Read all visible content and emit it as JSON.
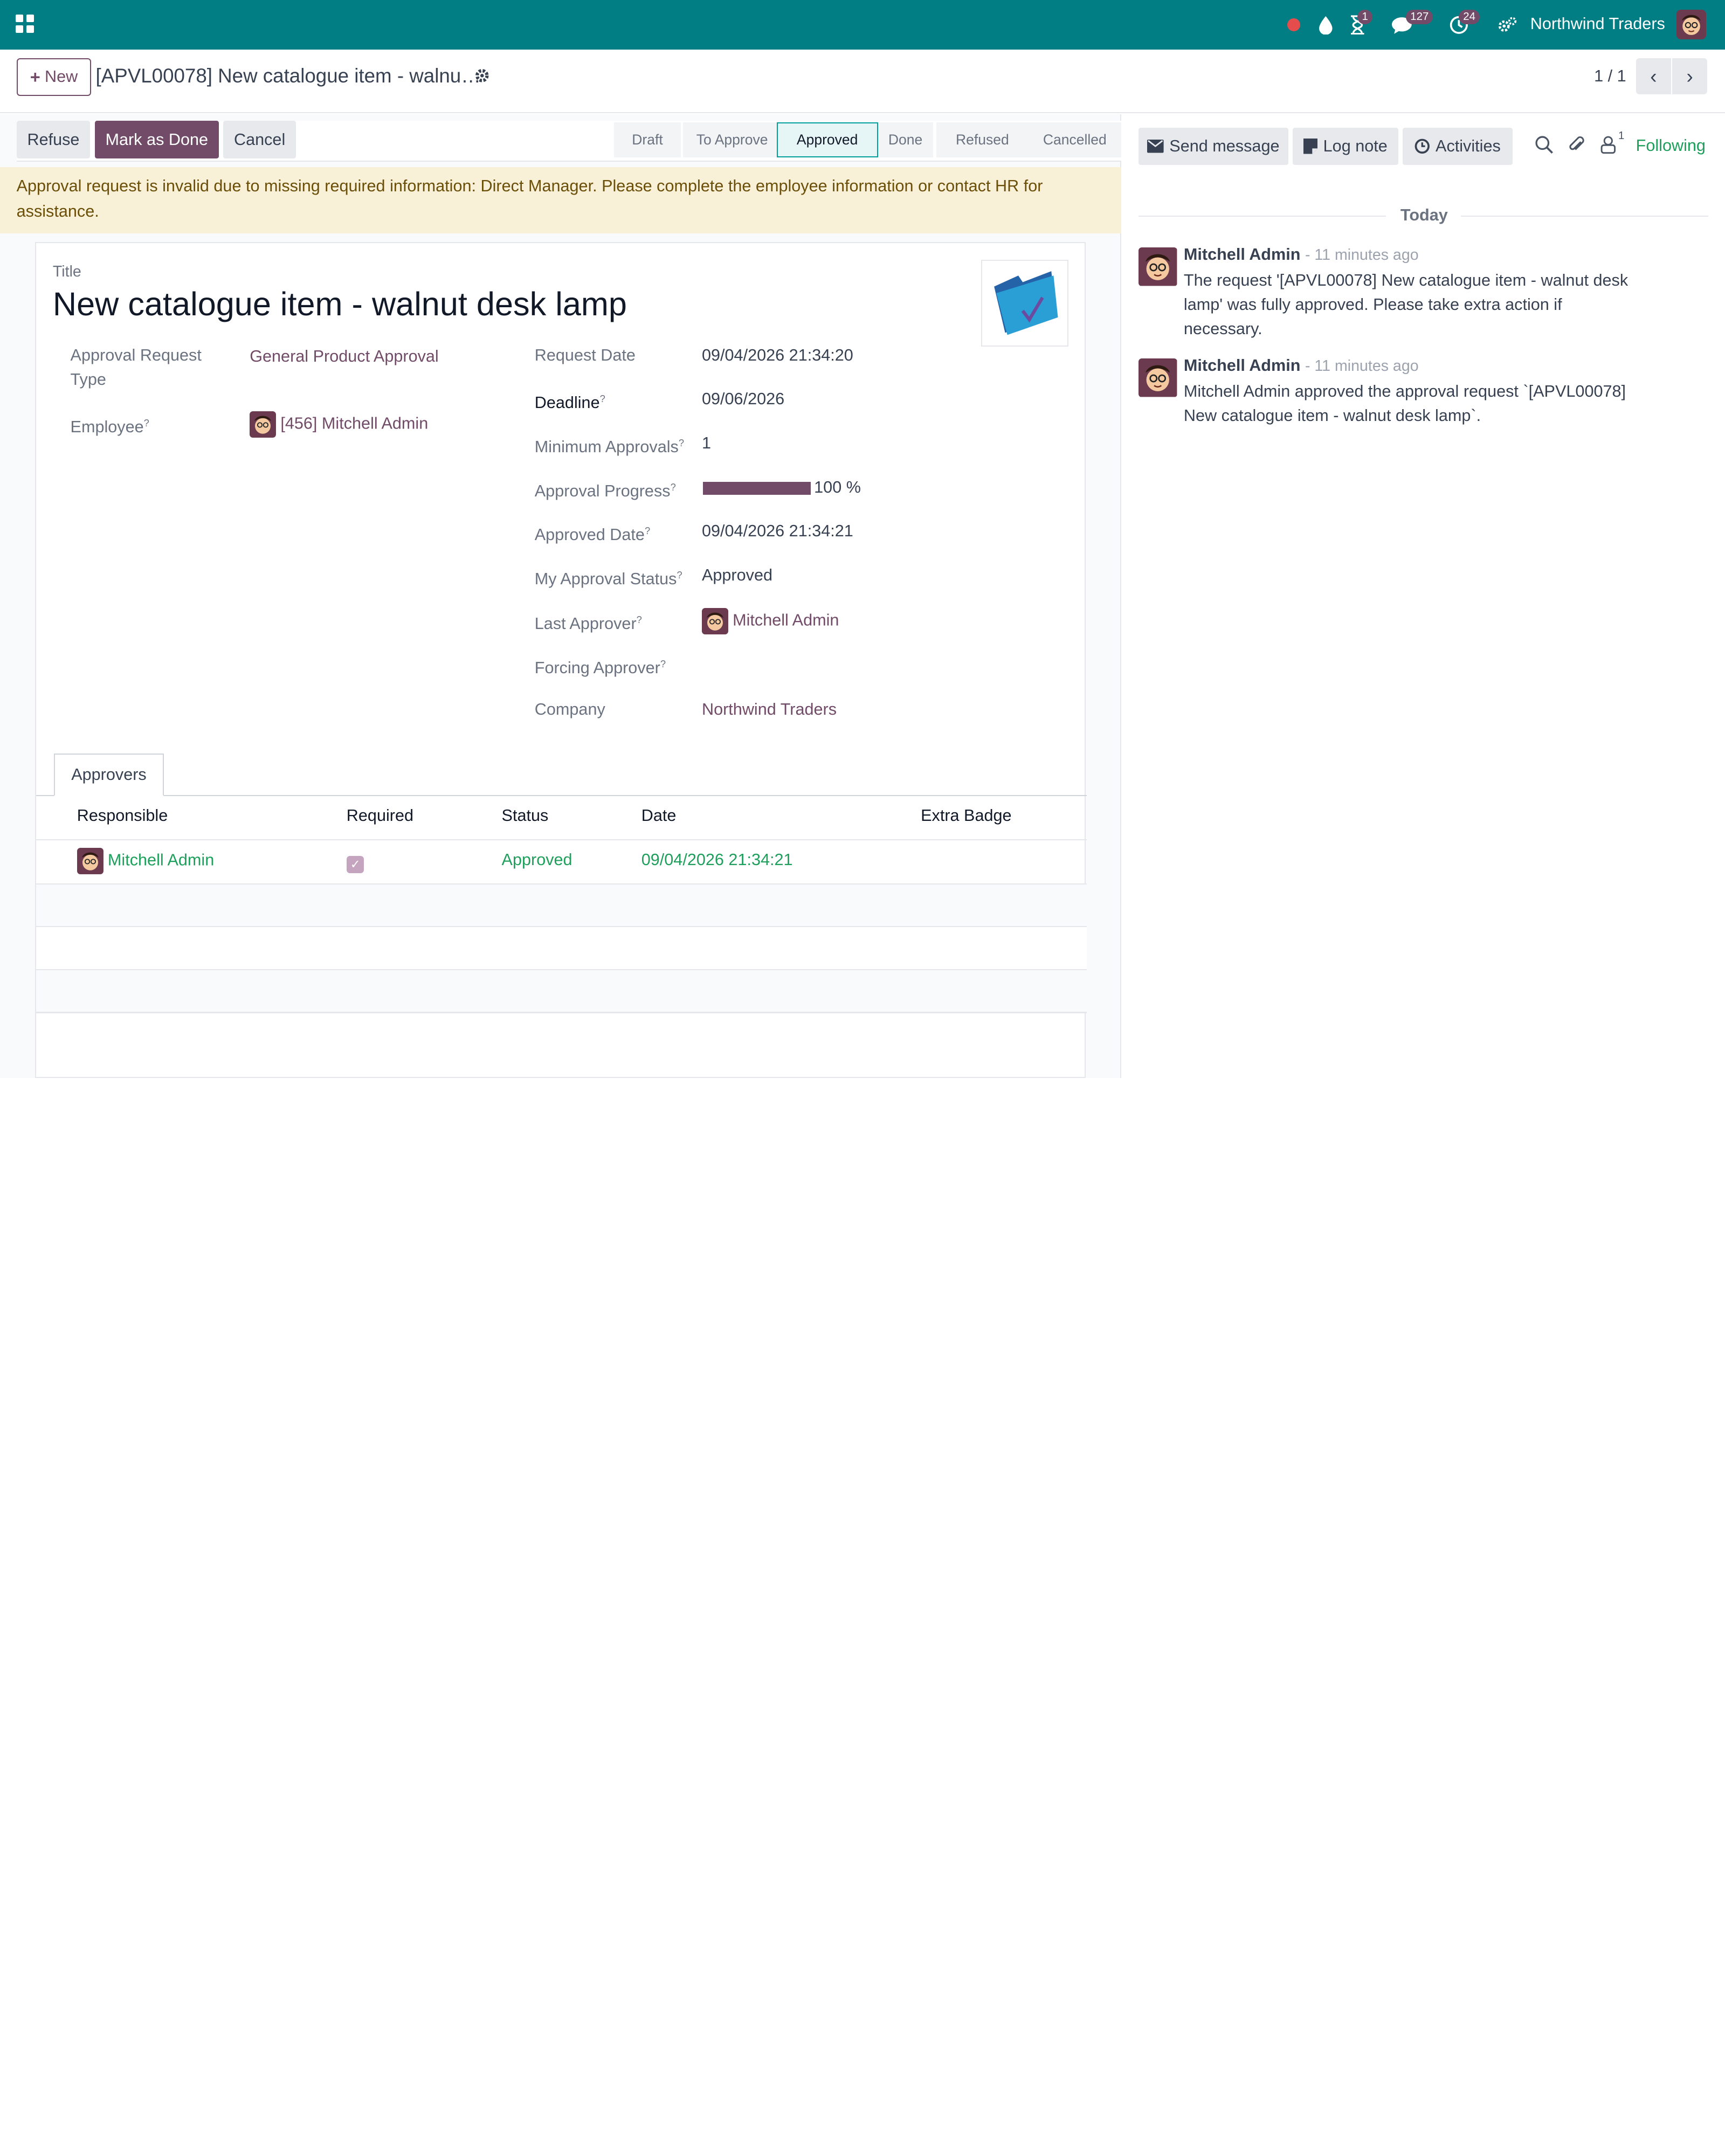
{
  "topbar": {
    "company": "Northwind Traders",
    "badges": {
      "activities": "1",
      "messages": "127",
      "clock": "24"
    }
  },
  "control": {
    "new_label": "New",
    "breadcrumb": "[APVL00078] New catalogue item - walnu…",
    "pager": "1 / 1"
  },
  "statusbar": {
    "buttons": {
      "refuse": "Refuse",
      "mark_done": "Mark as Done",
      "cancel": "Cancel"
    },
    "stages": [
      "Draft",
      "To Approve",
      "Approved",
      "Done",
      "Refused",
      "Cancelled"
    ],
    "active_stage": "Approved"
  },
  "alert": "Approval request is invalid due to missing required information: Direct Manager. Please complete the employee information or contact HR for assistance.",
  "form": {
    "title_label": "Title",
    "title": "New catalogue item - walnut desk lamp",
    "left": {
      "approval_type_label": "Approval Request Type",
      "approval_type_value": "General Product Approval",
      "employee_label": "Employee",
      "employee_value": "[456] Mitchell Admin"
    },
    "right": {
      "request_date_label": "Request Date",
      "request_date_value": "09/04/2026 21:34:20",
      "deadline_label": "Deadline",
      "deadline_value": "09/06/2026",
      "min_approvals_label": "Minimum Approvals",
      "min_approvals_value": "1",
      "progress_label": "Approval Progress",
      "progress_value": "100 %",
      "progress_fraction": 1.0,
      "approved_date_label": "Approved Date",
      "approved_date_value": "09/04/2026 21:34:21",
      "my_status_label": "My Approval Status",
      "my_status_value": "Approved",
      "last_approver_label": "Last Approver",
      "last_approver_value": "Mitchell Admin",
      "forcing_label": "Forcing Approver",
      "company_label": "Company",
      "company_value": "Northwind Traders"
    },
    "tab": "Approvers",
    "table": {
      "headers": [
        "Responsible",
        "Required",
        "Status",
        "Date",
        "Extra Badge"
      ],
      "rows": [
        {
          "responsible": "Mitchell Admin",
          "required": true,
          "status": "Approved",
          "date": "09/04/2026 21:34:21",
          "extra": ""
        }
      ]
    }
  },
  "chatter": {
    "send_message": "Send message",
    "log_note": "Log note",
    "activities": "Activities",
    "followers_count": "1",
    "following": "Following",
    "today": "Today",
    "messages": [
      {
        "author": "Mitchell Admin",
        "time": "- 11 minutes ago",
        "body": "The request '[APVL00078] New catalogue item - walnut desk lamp' was fully approved. Please take extra action if necessary."
      },
      {
        "author": "Mitchell Admin",
        "time": "- 11 minutes ago",
        "body": "Mitchell Admin approved the approval request `[APVL00078] New catalogue item - walnut desk lamp`."
      }
    ]
  },
  "colors": {
    "brand": "#017e84",
    "primary": "#714b67",
    "success": "#1f9f5c",
    "alert_bg": "#f8f0d7"
  }
}
